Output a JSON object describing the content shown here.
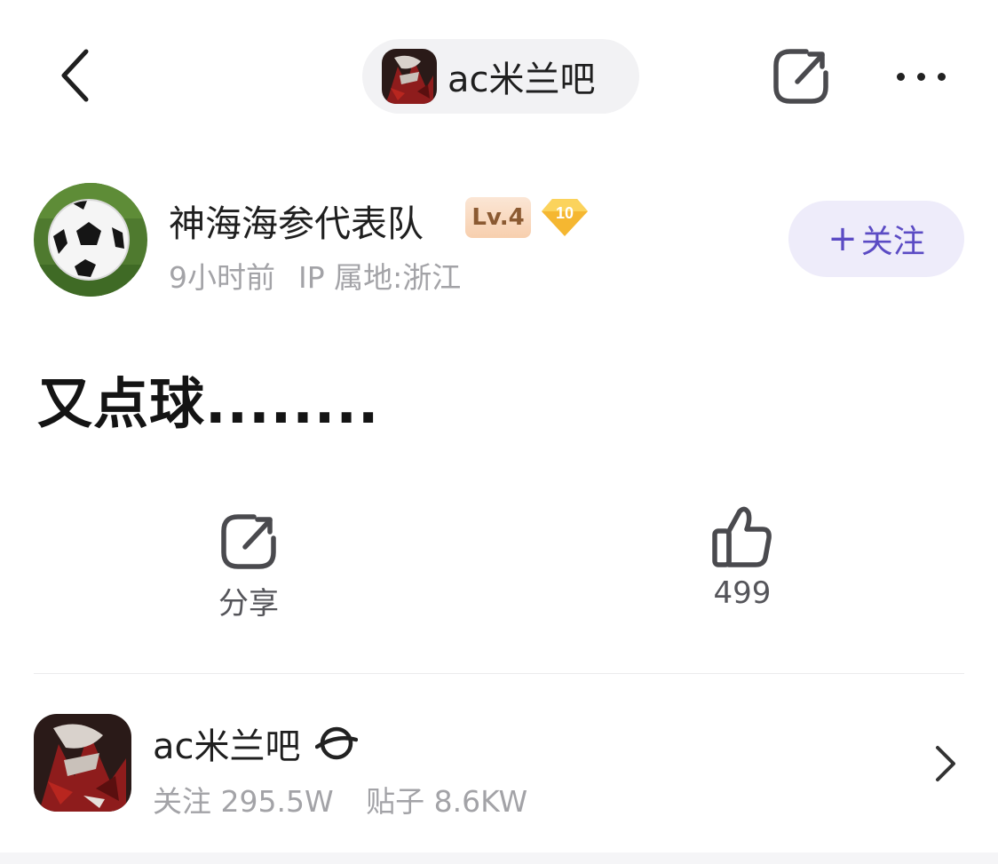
{
  "header": {
    "forum_name": "ac米兰吧",
    "icons": {
      "back": "back-arrow-icon",
      "share": "share-icon",
      "more": "more-dots-icon"
    }
  },
  "author": {
    "name": "神海海参代表队",
    "level": "Lv.4",
    "badge_level": "10",
    "time": "9小时前",
    "ip": "IP 属地:浙江",
    "follow_label": "关注",
    "follow_plus": "+"
  },
  "post": {
    "title": "又点球........"
  },
  "actions": {
    "share_label": "分享",
    "like_count": "499"
  },
  "forum_card": {
    "name": "ac米兰吧",
    "followers_label": "关注",
    "followers": "295.5W",
    "posts_label": "贴子",
    "posts": "8.6KW"
  },
  "colors": {
    "accent": "#5b4bc4",
    "follow_bg": "#eeecfa",
    "muted_text": "#a3a3a7",
    "level_badge": "#f7cfae",
    "gem_badge": "#f5b731"
  }
}
